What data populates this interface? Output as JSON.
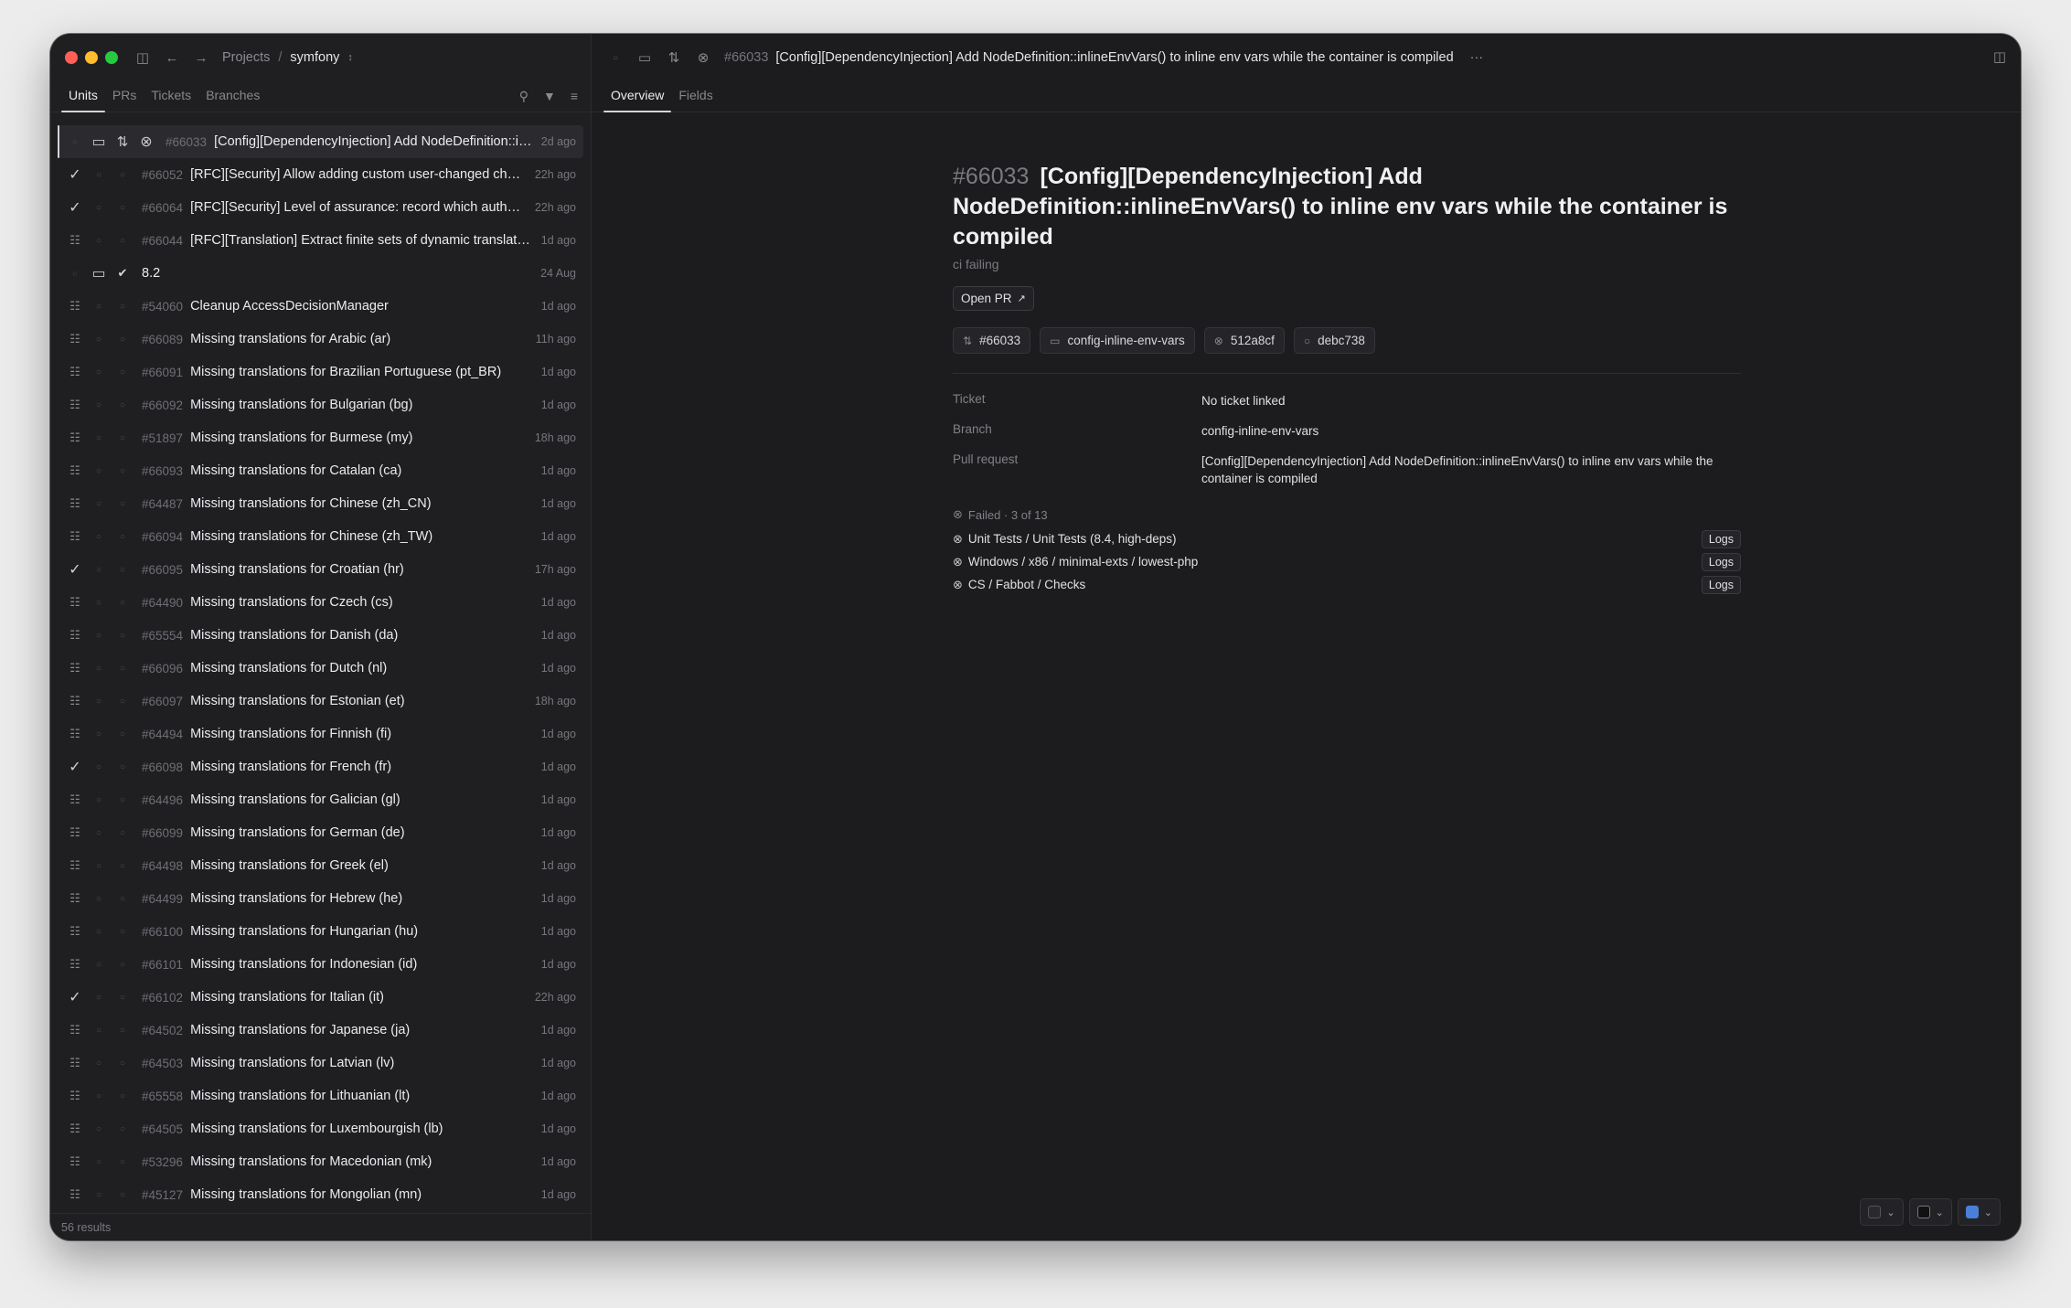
{
  "window": {
    "traffic_lights": [
      "#ff5f57",
      "#febc2e",
      "#28c840"
    ]
  },
  "left": {
    "breadcrumb": {
      "root": "Projects",
      "sep": "/",
      "project": "symfony"
    },
    "tabs": [
      {
        "label": "Units",
        "active": true
      },
      {
        "label": "PRs",
        "active": false
      },
      {
        "label": "Tickets",
        "active": false
      },
      {
        "label": "Branches",
        "active": false
      }
    ],
    "rows": [
      {
        "icon": "laptop-icon",
        "num": "#66033",
        "title": "[Config][DependencyInjection] Add NodeDefinition::inlineEnvVars() to inline env vars while the container is compiled",
        "time": "2d ago",
        "selected": true
      },
      {
        "icon": "check-icon",
        "num": "#66052",
        "title": "[RFC][Security] Allow adding custom user-changed checks",
        "time": "22h ago"
      },
      {
        "icon": "check-icon",
        "num": "#66064",
        "title": "[RFC][Security] Level of assurance: record which authenticator",
        "time": "22h ago"
      },
      {
        "icon": "ticket-icon",
        "num": "#66044",
        "title": "[RFC][Translation] Extract finite sets of dynamic translation keys",
        "time": "1d ago"
      },
      {
        "icon": "dot-icon",
        "num": "",
        "title": "8.2",
        "time": "24 Aug",
        "branch": true
      },
      {
        "icon": "ticket-icon",
        "num": "#54060",
        "title": "Cleanup AccessDecisionManager",
        "time": "1d ago"
      },
      {
        "icon": "ticket-icon",
        "num": "#66089",
        "title": "Missing translations for Arabic (ar)",
        "time": "11h ago"
      },
      {
        "icon": "ticket-icon",
        "num": "#66091",
        "title": "Missing translations for Brazilian Portuguese (pt_BR)",
        "time": "1d ago"
      },
      {
        "icon": "ticket-icon",
        "num": "#66092",
        "title": "Missing translations for Bulgarian (bg)",
        "time": "1d ago"
      },
      {
        "icon": "ticket-icon",
        "num": "#51897",
        "title": "Missing translations for Burmese (my)",
        "time": "18h ago"
      },
      {
        "icon": "ticket-icon",
        "num": "#66093",
        "title": "Missing translations for Catalan (ca)",
        "time": "1d ago"
      },
      {
        "icon": "ticket-icon",
        "num": "#64487",
        "title": "Missing translations for Chinese (zh_CN)",
        "time": "1d ago"
      },
      {
        "icon": "ticket-icon",
        "num": "#66094",
        "title": "Missing translations for Chinese (zh_TW)",
        "time": "1d ago"
      },
      {
        "icon": "check-icon",
        "num": "#66095",
        "title": "Missing translations for Croatian (hr)",
        "time": "17h ago"
      },
      {
        "icon": "ticket-icon",
        "num": "#64490",
        "title": "Missing translations for Czech (cs)",
        "time": "1d ago"
      },
      {
        "icon": "ticket-icon",
        "num": "#65554",
        "title": "Missing translations for Danish (da)",
        "time": "1d ago"
      },
      {
        "icon": "ticket-icon",
        "num": "#66096",
        "title": "Missing translations for Dutch (nl)",
        "time": "1d ago"
      },
      {
        "icon": "ticket-icon",
        "num": "#66097",
        "title": "Missing translations for Estonian (et)",
        "time": "18h ago"
      },
      {
        "icon": "ticket-icon",
        "num": "#64494",
        "title": "Missing translations for Finnish (fi)",
        "time": "1d ago"
      },
      {
        "icon": "check-icon",
        "num": "#66098",
        "title": "Missing translations for French (fr)",
        "time": "1d ago"
      },
      {
        "icon": "ticket-icon",
        "num": "#64496",
        "title": "Missing translations for Galician (gl)",
        "time": "1d ago"
      },
      {
        "icon": "ticket-icon",
        "num": "#66099",
        "title": "Missing translations for German (de)",
        "time": "1d ago"
      },
      {
        "icon": "ticket-icon",
        "num": "#64498",
        "title": "Missing translations for Greek (el)",
        "time": "1d ago"
      },
      {
        "icon": "ticket-icon",
        "num": "#64499",
        "title": "Missing translations for Hebrew (he)",
        "time": "1d ago"
      },
      {
        "icon": "ticket-icon",
        "num": "#66100",
        "title": "Missing translations for Hungarian (hu)",
        "time": "1d ago"
      },
      {
        "icon": "ticket-icon",
        "num": "#66101",
        "title": "Missing translations for Indonesian (id)",
        "time": "1d ago"
      },
      {
        "icon": "check-icon",
        "num": "#66102",
        "title": "Missing translations for Italian (it)",
        "time": "22h ago"
      },
      {
        "icon": "ticket-icon",
        "num": "#64502",
        "title": "Missing translations for Japanese (ja)",
        "time": "1d ago"
      },
      {
        "icon": "ticket-icon",
        "num": "#64503",
        "title": "Missing translations for Latvian (lv)",
        "time": "1d ago"
      },
      {
        "icon": "ticket-icon",
        "num": "#65558",
        "title": "Missing translations for Lithuanian (lt)",
        "time": "1d ago"
      },
      {
        "icon": "ticket-icon",
        "num": "#64505",
        "title": "Missing translations for Luxembourgish (lb)",
        "time": "1d ago"
      },
      {
        "icon": "ticket-icon",
        "num": "#53296",
        "title": "Missing translations for Macedonian (mk)",
        "time": "1d ago"
      },
      {
        "icon": "ticket-icon",
        "num": "#45127",
        "title": "Missing translations for Mongolian (mn)",
        "time": "1d ago"
      }
    ],
    "results": "56 results"
  },
  "right": {
    "header": {
      "num": "#66033",
      "title": "[Config][DependencyInjection] Add NodeDefinition::inlineEnvVars() to inline env vars while the container is compiled",
      "more": "···"
    },
    "tabs": [
      {
        "label": "Overview",
        "active": true
      },
      {
        "label": "Fields",
        "active": false
      }
    ],
    "detail": {
      "hash": "#66033",
      "title": "[Config][DependencyInjection] Add NodeDefinition::inlineEnvVars() to inline env vars while the container is compiled",
      "status": "ci failing",
      "open_pr": "Open PR",
      "chips": [
        {
          "icon": "pull-request-icon",
          "label": "#66033"
        },
        {
          "icon": "laptop-icon",
          "label": "config-inline-env-vars"
        },
        {
          "icon": "x-circle-icon",
          "label": "512a8cf"
        },
        {
          "icon": "circle-icon",
          "label": "debc738"
        }
      ],
      "fields": [
        {
          "key": "Ticket",
          "value": "No ticket linked"
        },
        {
          "key": "Branch",
          "value": "config-inline-env-vars"
        },
        {
          "key": "Pull request",
          "value": "[Config][DependencyInjection] Add NodeDefinition::inlineEnvVars() to inline env vars while the container is compiled"
        }
      ],
      "checks_summary": "Failed · 3 of 13",
      "checks": [
        {
          "label": "Unit Tests / Unit Tests (8.4, high-deps)",
          "button": "Logs"
        },
        {
          "label": "Windows / x86 / minimal-exts / lowest-php",
          "button": "Logs"
        },
        {
          "label": "CS / Fabbot / Checks",
          "button": "Logs"
        }
      ]
    },
    "controls": [
      "#e6e6ea",
      "#e6e6ea",
      "#4a7fd8"
    ]
  }
}
